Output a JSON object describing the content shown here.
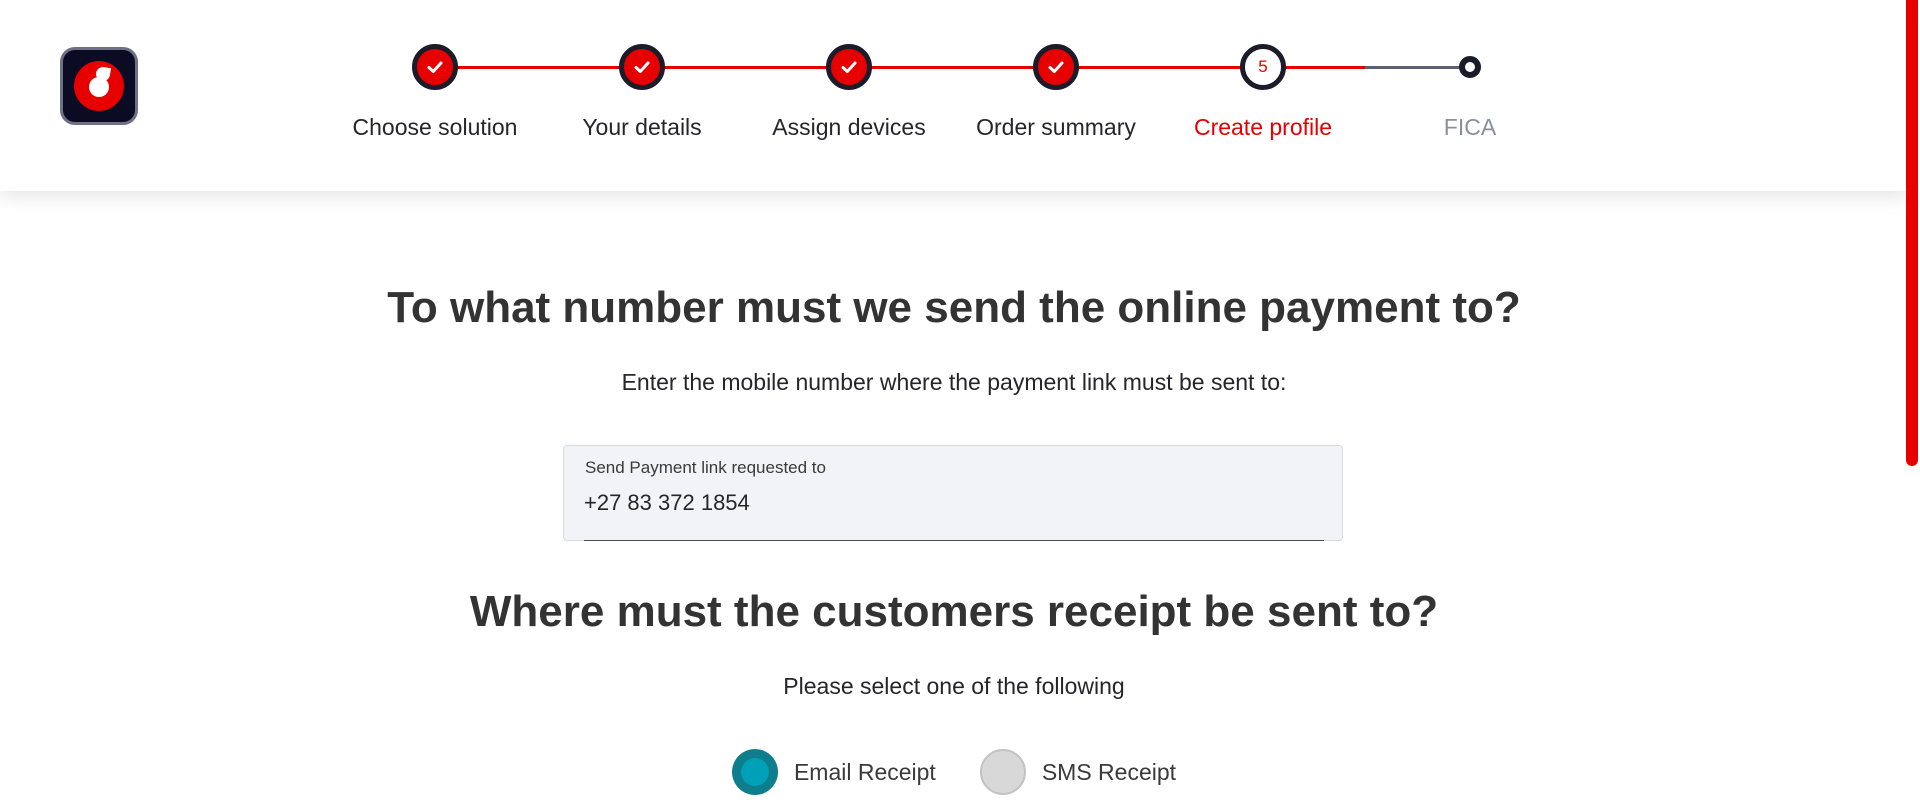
{
  "stepper": {
    "steps": [
      {
        "label": "Choose solution",
        "state": "complete"
      },
      {
        "label": "Your details",
        "state": "complete"
      },
      {
        "label": "Assign devices",
        "state": "complete"
      },
      {
        "label": "Order summary",
        "state": "complete"
      },
      {
        "label": "Create profile",
        "state": "current",
        "number": "5"
      },
      {
        "label": "FICA",
        "state": "pending"
      }
    ]
  },
  "payment": {
    "heading": "To what number must we send the online payment to?",
    "instruction": "Enter the mobile number where the payment link must be sent to:",
    "field_label": "Send Payment link requested to",
    "field_value": "+27 83 372 1854"
  },
  "receipt": {
    "heading": "Where must the customers receipt be sent to?",
    "instruction": "Please select one of the following",
    "options": [
      {
        "label": "Email Receipt",
        "selected": true
      },
      {
        "label": "SMS Receipt",
        "selected": false
      }
    ]
  },
  "colors": {
    "brand_red": "#e60000",
    "radio_selected": "#00a0b8"
  },
  "icons": {
    "logo": "vodafone-logo-icon",
    "complete_step": "check-icon"
  }
}
